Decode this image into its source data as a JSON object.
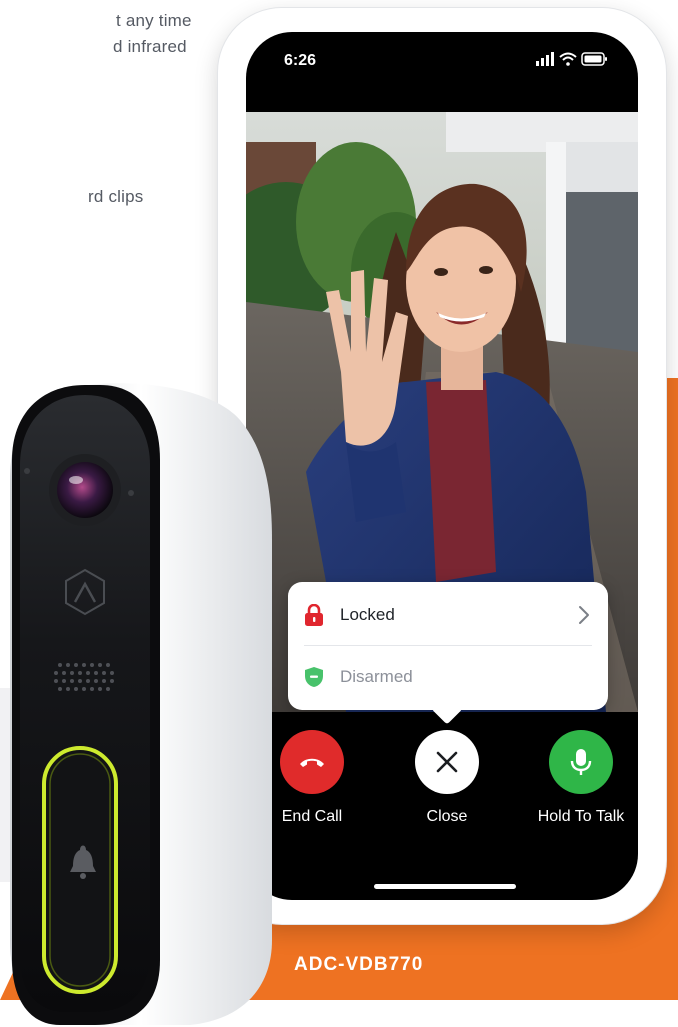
{
  "feature_text": {
    "line1": "t any time",
    "line2": "d infrared",
    "line3": "rd clips"
  },
  "phone": {
    "status_time": "6:26",
    "popup": {
      "locked_label": "Locked",
      "disarmed_label": "Disarmed"
    },
    "call_controls": {
      "end_label": "End Call",
      "close_label": "Close",
      "talk_label": "Hold To Talk"
    }
  },
  "product": {
    "model": "ADC-VDB770"
  },
  "colors": {
    "accent_orange": "#ee7222",
    "end_call_red": "#e02b2b",
    "talk_green": "#2fb648",
    "locked_red": "#e0262e",
    "disarmed_green": "#48c26b",
    "doorbell_ring": "#cdea2e"
  }
}
